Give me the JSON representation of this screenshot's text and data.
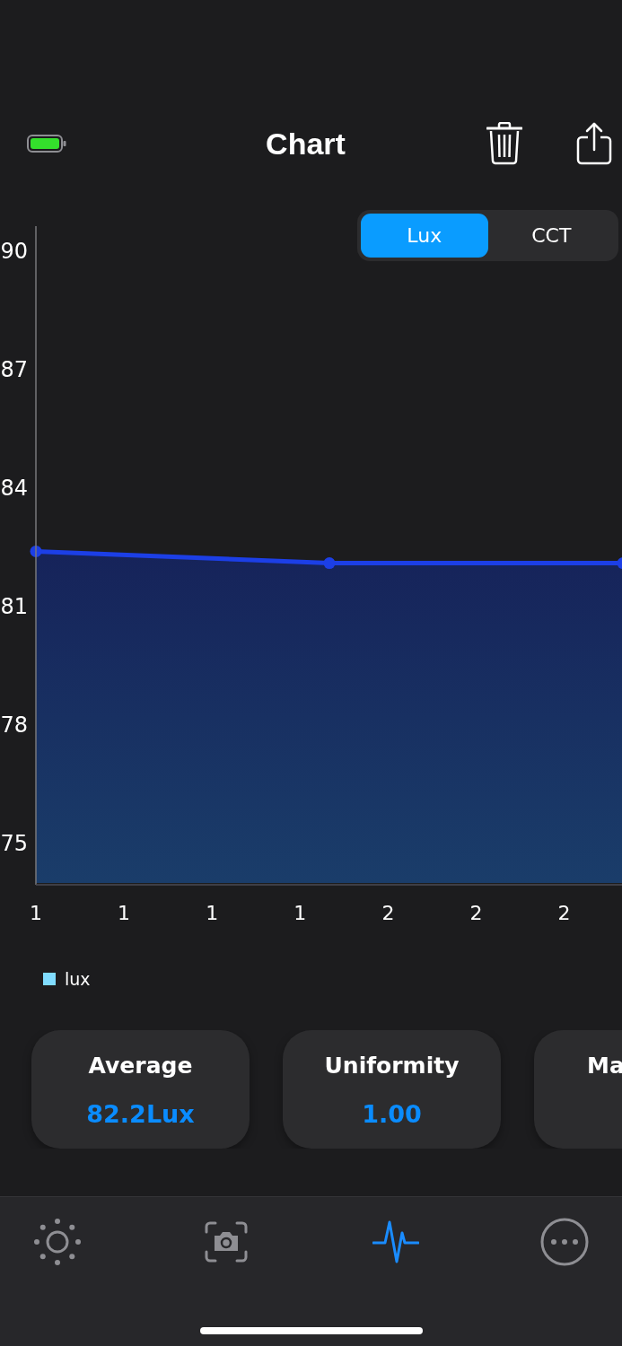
{
  "header": {
    "title": "Chart"
  },
  "segments": [
    {
      "label": "Lux",
      "selected": true
    },
    {
      "label": "CCT",
      "selected": false
    }
  ],
  "chart": {
    "legend": {
      "color": "#80dcff"
    },
    "chart_data": {
      "type": "area",
      "x": [
        0.55,
        1.55,
        2.55
      ],
      "series": [
        {
          "name": "lux",
          "color": "#1c3fe6",
          "values": [
            82.4,
            82.1,
            82.1
          ]
        }
      ],
      "xlim": [
        0.55,
        2.55
      ],
      "ylim": [
        74,
        90.6
      ],
      "xticks": [
        {
          "value": 0.55,
          "label": "1"
        },
        {
          "value": 0.85,
          "label": "1"
        },
        {
          "value": 1.15,
          "label": "1"
        },
        {
          "value": 1.45,
          "label": "1"
        },
        {
          "value": 1.75,
          "label": "2"
        },
        {
          "value": 2.05,
          "label": "2"
        },
        {
          "value": 2.35,
          "label": "2"
        }
      ],
      "yticks": [
        75,
        78,
        81,
        84,
        87,
        90
      ]
    }
  },
  "stats": [
    {
      "kind": "full",
      "label": "Average",
      "value": "82.2Lux"
    },
    {
      "kind": "full",
      "label": "Uniformity",
      "value": "1.00"
    },
    {
      "kind": "clipped",
      "label": "Ma"
    }
  ],
  "tabs": [
    {
      "selected": false
    },
    {
      "selected": false
    },
    {
      "selected": true
    },
    {
      "selected": false
    }
  ]
}
